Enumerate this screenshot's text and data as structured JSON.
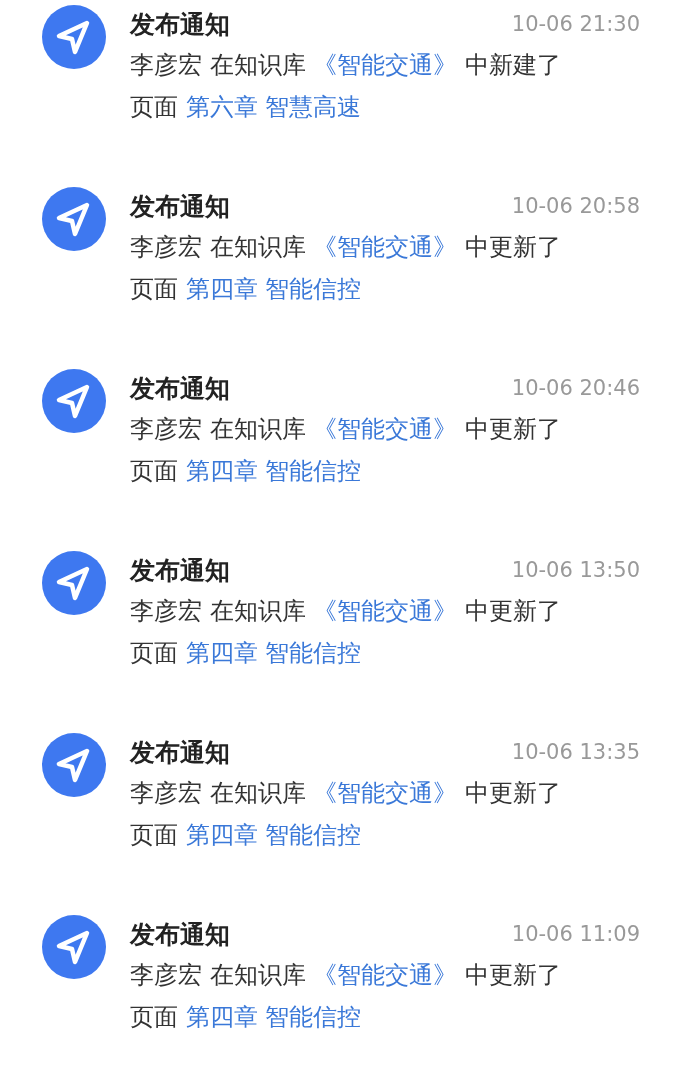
{
  "notifications": [
    {
      "title": "发布通知",
      "time": "10-06 21:30",
      "lines": [
        [
          {
            "kind": "text",
            "text": "李彦宏 在知识库 "
          },
          {
            "kind": "link",
            "text": "《智能交通》"
          },
          {
            "kind": "text",
            "text": " 中新建了"
          }
        ],
        [
          {
            "kind": "text",
            "text": "页面 "
          },
          {
            "kind": "link",
            "text": "第六章 智慧高速"
          }
        ]
      ]
    },
    {
      "title": "发布通知",
      "time": "10-06 20:58",
      "lines": [
        [
          {
            "kind": "text",
            "text": "李彦宏 在知识库 "
          },
          {
            "kind": "link",
            "text": "《智能交通》"
          },
          {
            "kind": "text",
            "text": " 中更新了"
          }
        ],
        [
          {
            "kind": "text",
            "text": "页面 "
          },
          {
            "kind": "link",
            "text": "第四章 智能信控"
          }
        ]
      ]
    },
    {
      "title": "发布通知",
      "time": "10-06 20:46",
      "lines": [
        [
          {
            "kind": "text",
            "text": "李彦宏 在知识库 "
          },
          {
            "kind": "link",
            "text": "《智能交通》"
          },
          {
            "kind": "text",
            "text": " 中更新了"
          }
        ],
        [
          {
            "kind": "text",
            "text": "页面 "
          },
          {
            "kind": "link",
            "text": "第四章 智能信控"
          }
        ]
      ]
    },
    {
      "title": "发布通知",
      "time": "10-06 13:50",
      "lines": [
        [
          {
            "kind": "text",
            "text": "李彦宏 在知识库 "
          },
          {
            "kind": "link",
            "text": "《智能交通》"
          },
          {
            "kind": "text",
            "text": " 中更新了"
          }
        ],
        [
          {
            "kind": "text",
            "text": "页面 "
          },
          {
            "kind": "link",
            "text": "第四章 智能信控"
          }
        ]
      ]
    },
    {
      "title": "发布通知",
      "time": "10-06 13:35",
      "lines": [
        [
          {
            "kind": "text",
            "text": "李彦宏 在知识库 "
          },
          {
            "kind": "link",
            "text": "《智能交通》"
          },
          {
            "kind": "text",
            "text": " 中更新了"
          }
        ],
        [
          {
            "kind": "text",
            "text": "页面 "
          },
          {
            "kind": "link",
            "text": "第四章 智能信控"
          }
        ]
      ]
    },
    {
      "title": "发布通知",
      "time": "10-06 11:09",
      "lines": [
        [
          {
            "kind": "text",
            "text": "李彦宏 在知识库 "
          },
          {
            "kind": "link",
            "text": "《智能交通》"
          },
          {
            "kind": "text",
            "text": " 中更新了"
          }
        ],
        [
          {
            "kind": "text",
            "text": "页面 "
          },
          {
            "kind": "link",
            "text": "第四章 智能信控"
          }
        ]
      ]
    }
  ]
}
